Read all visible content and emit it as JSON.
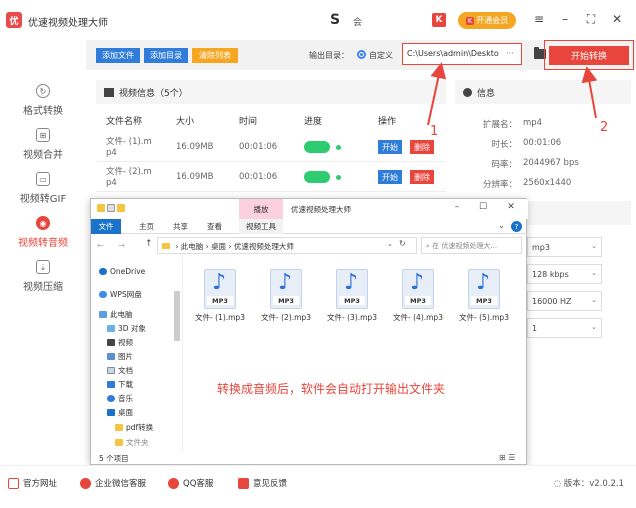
{
  "app": {
    "logo_text": "优",
    "title": "优速视频处理大师",
    "brand_mark": "S",
    "brand_mark2": "会",
    "red_icon": "K",
    "vip_k": "K",
    "vip_label": "开通会员",
    "win_menu": "≡",
    "win_min": "–",
    "win_max": "⛶",
    "win_close": "✕"
  },
  "sidebar": {
    "items": [
      {
        "label": "格式转换",
        "icon": "↻"
      },
      {
        "label": "视频合并",
        "icon": "⊞"
      },
      {
        "label": "视频转GIF",
        "icon": "▭"
      },
      {
        "label": "视频转音频",
        "icon": "◉",
        "active": true
      },
      {
        "label": "视频压缩",
        "icon": "⇣"
      }
    ]
  },
  "toolbar": {
    "add_file": "添加文件",
    "add_dir": "添加目录",
    "clear_list": "清除列表",
    "output_dir_label": "输出目录：",
    "custom_label": "自定义",
    "path_value": "C:\\Users\\admin\\Deskto",
    "path_more": "···",
    "start_convert": "开始转换",
    "colors": {
      "blue": "#2f7dd8",
      "yellow": "#f5a623",
      "red": "#e8453c"
    }
  },
  "video_panel": {
    "title": "视频信息（5个）",
    "headers": [
      "文件名称",
      "大小",
      "时间",
      "进度",
      "操作"
    ],
    "rows": [
      {
        "name1": "文件- (1).m",
        "name2": "p4",
        "size": "16.09MB",
        "time": "00:01:06",
        "start": "开始",
        "del": "删除"
      },
      {
        "name1": "文件- (2).m",
        "name2": "p4",
        "size": "16.09MB",
        "time": "00:01:06",
        "start": "开始",
        "del": "删除"
      }
    ]
  },
  "info_panel": {
    "title": "信息",
    "rows": [
      {
        "key": "扩展名：",
        "val": "mp4"
      },
      {
        "key": "时长：",
        "val": "00:01:06"
      },
      {
        "key": "码率：",
        "val": "2044967 bps"
      },
      {
        "key": "分辨率：",
        "val": "2560x1440"
      }
    ]
  },
  "settings": {
    "selects": [
      "mp3",
      "128 kbps",
      "16000 HZ",
      "1"
    ]
  },
  "annotations": {
    "one": "1",
    "two": "2"
  },
  "explorer": {
    "play_tab": "播放",
    "window_title": "优速视频处理大师",
    "win_min": "–",
    "win_max": "☐",
    "win_close": "✕",
    "tabs": {
      "file": "文件",
      "home": "主页",
      "share": "共享",
      "view": "查看",
      "tools": "视频工具"
    },
    "collapse": "⌄",
    "help": "?",
    "nav_arrows": "← →",
    "up": "↑",
    "breadcrumb": [
      "此电脑",
      "桌面",
      "优速视频处理大师"
    ],
    "sep": "›",
    "path_drop": "⌄",
    "refresh": "↻",
    "search_placeholder": "在 优速视频处理大...",
    "nav_items": [
      "OneDrive",
      "WPS网盘",
      "此电脑",
      "3D 对象",
      "视频",
      "图片",
      "文档",
      "下载",
      "音乐",
      "桌面",
      "pdf转换",
      "文件夹"
    ],
    "files": [
      "文件- (1).mp3",
      "文件- (2).mp3",
      "文件- (3).mp3",
      "文件- (4).mp3",
      "文件- (5).mp3"
    ],
    "mp3_tag": "MP3",
    "note_glyph": "♪",
    "note_text": "转换成音频后，软件会自动打开输出文件夹",
    "item_count": "5 个项目",
    "view_btns": "⊞ ☰"
  },
  "bottom": {
    "website": "官方网址",
    "wechat": "企业微信客服",
    "qq": "QQ客服",
    "feedback": "意见反馈",
    "version": "版本：v2.0.2.1",
    "version_icon": "◌"
  }
}
